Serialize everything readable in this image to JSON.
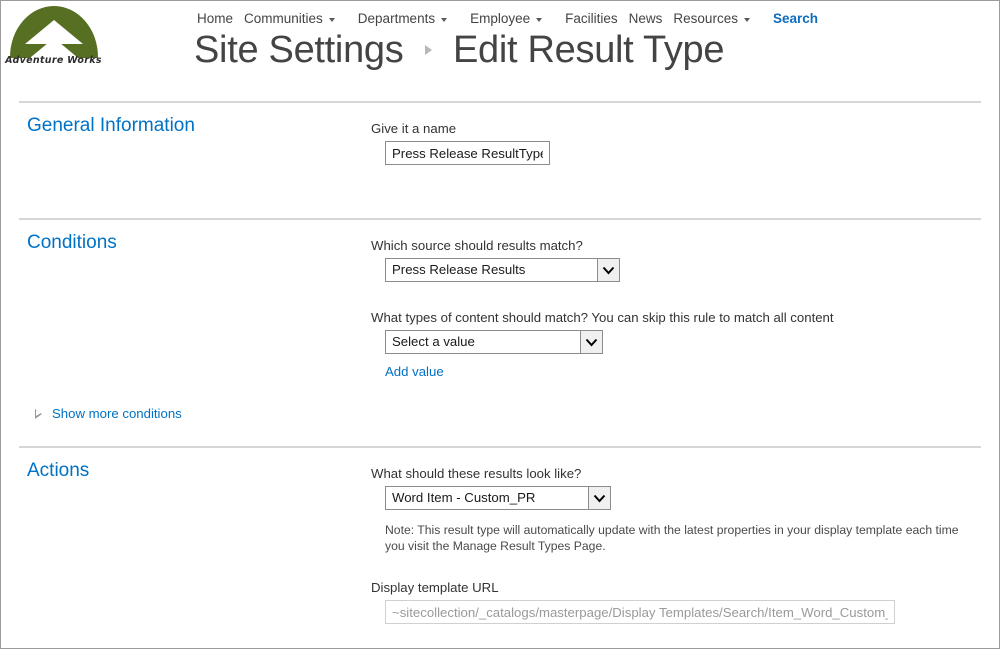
{
  "branding": {
    "logo_text": "Adventure Works",
    "logo_color": "#566F23"
  },
  "nav": {
    "items": [
      {
        "label": "Home",
        "has_caret": false,
        "active": false
      },
      {
        "label": "Communities",
        "has_caret": true,
        "active": false
      },
      {
        "label": "Departments",
        "has_caret": true,
        "active": false
      },
      {
        "label": "Employee",
        "has_caret": true,
        "active": false
      },
      {
        "label": "Facilities",
        "has_caret": false,
        "active": false
      },
      {
        "label": "News",
        "has_caret": false,
        "active": false
      },
      {
        "label": "Resources",
        "has_caret": true,
        "active": false
      },
      {
        "label": "Search",
        "has_caret": false,
        "active": true
      }
    ],
    "active_color": "#0f6cbd"
  },
  "title": {
    "parent": "Site Settings",
    "current": "Edit Result Type"
  },
  "sections": {
    "general": {
      "heading": "General Information",
      "name_label": "Give it a name",
      "name_value": "Press Release ResultType"
    },
    "conditions": {
      "heading": "Conditions",
      "source_label": "Which source should results match?",
      "source_value": "Press Release Results",
      "content_label": "What types of content should match? You can skip this rule to match all content",
      "content_value": "Select a value",
      "add_value_link": "Add value",
      "show_more_link": "Show more conditions"
    },
    "actions": {
      "heading": "Actions",
      "look_label": "What should these results look like?",
      "look_value": "Word Item - Custom_PR",
      "note": "Note: This result type will automatically update with the latest properties in your display template each time you visit the Manage Result Types Page.",
      "url_label": "Display template URL",
      "url_value": "~sitecollection/_catalogs/masterpage/Display Templates/Search/Item_Word_Custom_PR.js"
    }
  },
  "colors": {
    "heading_blue": "#0072c6",
    "link_blue": "#0072c6",
    "divider": "#d6d6d6"
  }
}
